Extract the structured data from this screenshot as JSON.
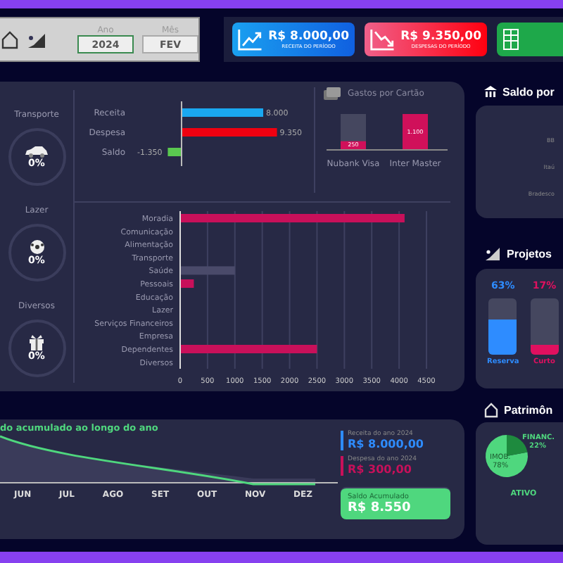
{
  "header": {
    "year": {
      "label": "Ano",
      "value": "2024"
    },
    "month": {
      "label": "Mês",
      "value": "FEV"
    }
  },
  "kpis": [
    {
      "kind": "income",
      "value": "R$ 8.000,00",
      "caption": "RECEITA DO PERÍODO"
    },
    {
      "kind": "expense",
      "value": "R$ 9.350,00",
      "caption": "DESPESAS DO PERÍODO"
    },
    {
      "kind": "sheet"
    }
  ],
  "budget_rings": [
    {
      "kind": "car",
      "label": "Transporte",
      "value": "0%"
    },
    {
      "kind": "ball",
      "label": "Lazer",
      "value": "0%"
    },
    {
      "kind": "gift",
      "label": "Diversos",
      "value": "0%"
    }
  ],
  "summary": {
    "chart_data": {
      "type": "bar",
      "orientation": "horizontal",
      "categories": [
        "Receita",
        "Despesa",
        "Saldo"
      ],
      "values": [
        8000,
        9350,
        -1350
      ],
      "value_labels": [
        "8.000",
        "9.350",
        "-1.350"
      ]
    }
  },
  "cards": {
    "title": "Gastos por Cartão",
    "chart_data": {
      "type": "bar",
      "categories": [
        "Nubank Visa",
        "Inter Master"
      ],
      "values": [
        250,
        1100
      ],
      "value_labels": [
        "250",
        "1.100"
      ]
    }
  },
  "categories": {
    "chart_data": {
      "type": "bar",
      "orientation": "horizontal",
      "categories": [
        "Moradia",
        "Comunicação",
        "Alimentação",
        "Transporte",
        "Saúde",
        "Pessoais",
        "Educação",
        "Lazer",
        "Serviços Financeiros",
        "Empresa",
        "Dependentes",
        "Diversos"
      ],
      "series": [
        {
          "color": "#c8105a",
          "values": [
            4100,
            0,
            0,
            0,
            0,
            250,
            0,
            0,
            0,
            0,
            2500,
            0
          ]
        },
        {
          "color": "#4a4a6a",
          "values": [
            0,
            0,
            0,
            0,
            1000,
            0,
            0,
            0,
            0,
            0,
            0,
            0
          ]
        }
      ],
      "xlim": [
        0,
        4500
      ],
      "grid": true,
      "xticks": [
        0,
        500,
        1000,
        1500,
        2000,
        2500,
        3000,
        3500,
        4000,
        4500
      ]
    }
  },
  "yearly": {
    "title": "do acumulado ao longo do ano",
    "months": [
      "JUN",
      "JUL",
      "AGO",
      "SET",
      "OUT",
      "NOV",
      "DEZ"
    ],
    "income": {
      "label": "Receita do ano 2024",
      "value": "R$ 8.000,00"
    },
    "expense": {
      "label": "Despesa do ano 2024",
      "value": "R$ 300,00"
    },
    "balance": {
      "label": "Saldo Acumulado",
      "value": "R$ 8.550"
    }
  },
  "accounts": {
    "title": "Saldo por",
    "items": [
      "BB",
      "Itaú",
      "Bradesco"
    ]
  },
  "projects": {
    "title": "Projetos",
    "items": [
      {
        "pct": "63%",
        "name": "Reserva",
        "level": 0.63,
        "color": "#2e8cff"
      },
      {
        "pct": "17%",
        "name": "Curto",
        "level": 0.17,
        "color": "#e0105f"
      }
    ]
  },
  "assets": {
    "title": "Patrimôn",
    "label": "ATIVO",
    "chart_data": {
      "type": "pie",
      "categories": [
        "IMOB.",
        "FINANC."
      ],
      "values": [
        78,
        22
      ],
      "value_labels": [
        "78%",
        "22%"
      ]
    }
  }
}
